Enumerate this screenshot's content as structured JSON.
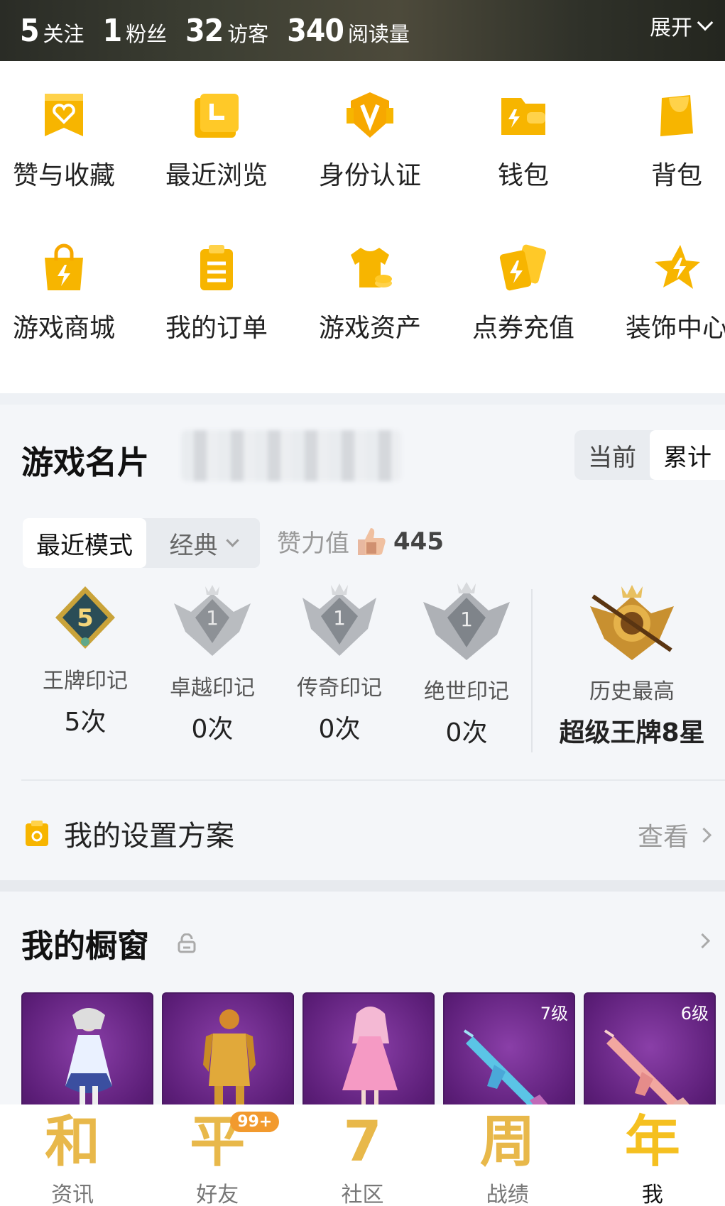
{
  "header": {
    "stats": [
      {
        "value": "5",
        "label": "关注"
      },
      {
        "value": "1",
        "label": "粉丝"
      },
      {
        "value": "32",
        "label": "访客"
      },
      {
        "value": "340",
        "label": "阅读量"
      }
    ],
    "expand_label": "展开"
  },
  "functions": [
    {
      "label": "赞与收藏",
      "icon": "like-bookmark-icon"
    },
    {
      "label": "最近浏览",
      "icon": "recent-browse-icon"
    },
    {
      "label": "身份认证",
      "icon": "verify-badge-icon"
    },
    {
      "label": "钱包",
      "icon": "wallet-icon"
    },
    {
      "label": "背包",
      "icon": "backpack-icon"
    },
    {
      "label": "游戏商城",
      "icon": "shop-bag-icon"
    },
    {
      "label": "我的订单",
      "icon": "order-clipboard-icon"
    },
    {
      "label": "游戏资产",
      "icon": "tshirt-coin-icon"
    },
    {
      "label": "点券充值",
      "icon": "coupon-card-icon"
    },
    {
      "label": "装饰中心",
      "icon": "star-decoration-icon"
    }
  ],
  "game_card": {
    "title": "游戏名片",
    "toggle": {
      "current": "当前",
      "cumulative": "累计",
      "selected": "累计"
    },
    "mode_tabs": {
      "recent": "最近模式",
      "classic": "经典"
    },
    "power_label": "赞力值",
    "power_value": "445",
    "badges": [
      {
        "label": "王牌印记",
        "value": "5次",
        "icon": "ace-badge-icon"
      },
      {
        "label": "卓越印记",
        "value": "0次",
        "icon": "excellence-badge-icon"
      },
      {
        "label": "传奇印记",
        "value": "0次",
        "icon": "legend-badge-icon"
      },
      {
        "label": "绝世印记",
        "value": "0次",
        "icon": "peerless-badge-icon"
      }
    ],
    "best": {
      "label": "历史最高",
      "value": "超级王牌8星",
      "icon": "conqueror-badge-icon"
    },
    "settings_label": "我的设置方案",
    "view_label": "查看"
  },
  "showcase": {
    "title": "我的橱窗",
    "items": [
      {
        "level": "",
        "icon": "outfit-white-dress-icon"
      },
      {
        "level": "",
        "icon": "outfit-golden-armor-icon"
      },
      {
        "level": "",
        "icon": "outfit-pink-dress-icon"
      },
      {
        "level": "7级",
        "icon": "rifle-skin-blue-icon"
      },
      {
        "level": "6级",
        "icon": "rifle-skin-pink-icon"
      }
    ]
  },
  "nav": [
    {
      "glyph": "和",
      "label": "资讯",
      "badge": ""
    },
    {
      "glyph": "平",
      "label": "好友",
      "badge": "99+"
    },
    {
      "glyph": "7",
      "label": "社区",
      "badge": ""
    },
    {
      "glyph": "周",
      "label": "战绩",
      "badge": ""
    },
    {
      "glyph": "年",
      "label": "我",
      "badge": ""
    }
  ],
  "colors": {
    "accent_yellow": "#f5b800",
    "card_bg": "#f4f6f9",
    "showcase_purple": "#5c1e78"
  }
}
